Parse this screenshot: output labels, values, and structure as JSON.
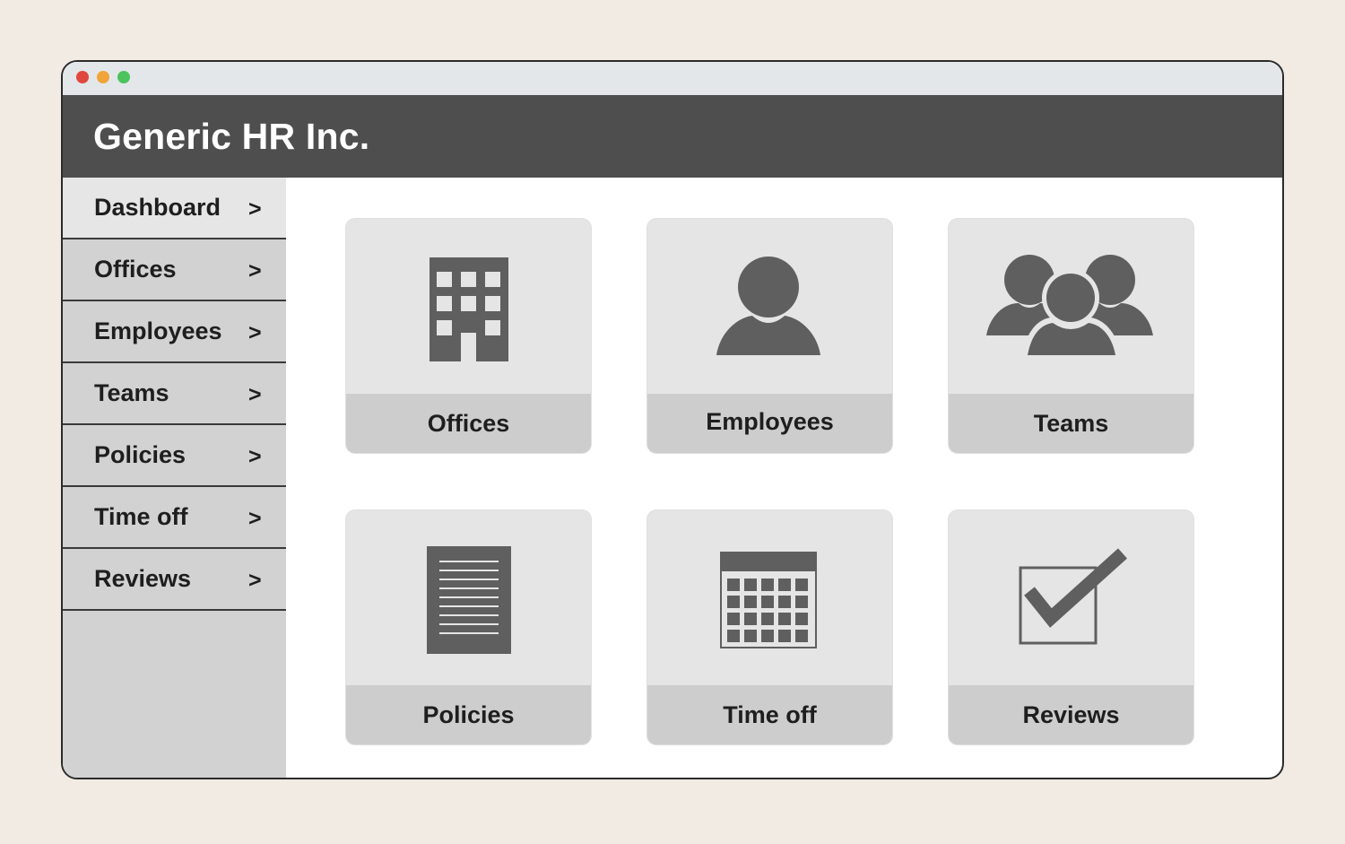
{
  "app": {
    "title": "Generic HR Inc."
  },
  "sidebar": {
    "items": [
      {
        "label": "Dashboard",
        "chevron": ">",
        "active": true
      },
      {
        "label": "Offices",
        "chevron": ">"
      },
      {
        "label": "Employees",
        "chevron": ">"
      },
      {
        "label": "Teams",
        "chevron": ">"
      },
      {
        "label": "Policies",
        "chevron": ">"
      },
      {
        "label": "Time off",
        "chevron": ">"
      },
      {
        "label": "Reviews",
        "chevron": ">"
      }
    ]
  },
  "tiles": [
    {
      "label": "Offices",
      "icon": "building-icon"
    },
    {
      "label": "Employees",
      "icon": "person-icon"
    },
    {
      "label": "Teams",
      "icon": "group-icon"
    },
    {
      "label": "Policies",
      "icon": "document-icon"
    },
    {
      "label": "Time off",
      "icon": "calendar-icon"
    },
    {
      "label": "Reviews",
      "icon": "checkbox-icon"
    }
  ],
  "colors": {
    "page_background": "#f2ebe3",
    "header": "#4e4e4e",
    "sidebar": "#d2d2d2",
    "sidebar_active": "#e6e6e6",
    "tile": "#e5e5e5",
    "tile_caption": "#cdcdcd",
    "icon": "#5f5f5f"
  }
}
